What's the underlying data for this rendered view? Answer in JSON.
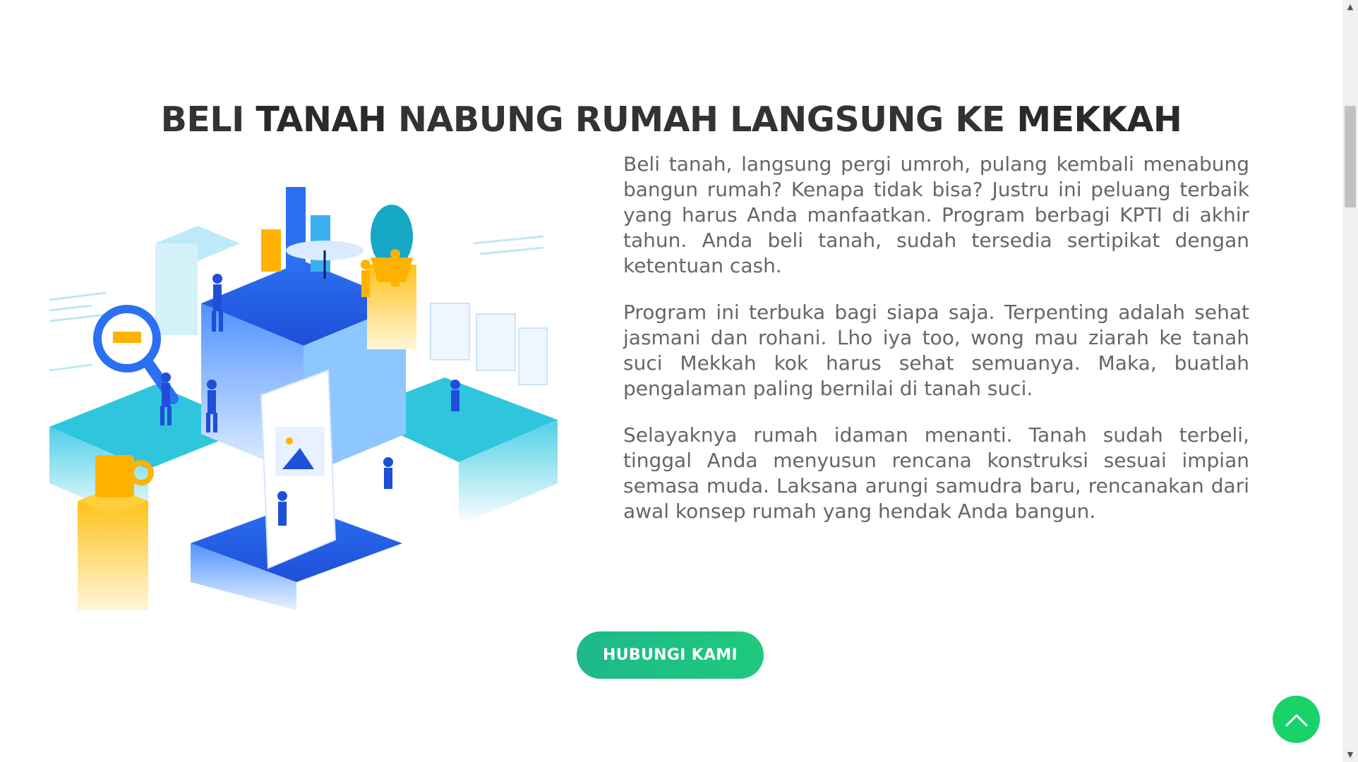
{
  "heading": {
    "part1": "BELI ",
    "bold1": "TANAH",
    "part2": " NABUNG RUMAH LANGSUNG KE ",
    "bold2": "MEKKAH"
  },
  "paragraphs": [
    "Beli tanah, langsung pergi umroh, pulang kembali menabung bangun rumah? Kenapa tidak bisa? Justru ini peluang terbaik yang harus Anda manfaatkan. Program berbagi KPTI di akhir tahun. Anda beli tanah, sudah tersedia sertipikat dengan ketentuan cash.",
    "Program ini terbuka bagi siapa saja. Terpenting adalah sehat jasmani dan rohani. Lho iya too, wong mau ziarah ke tanah suci Mekkah kok harus sehat semuanya. Maka, buatlah pengalaman paling bernilai di tanah suci.",
    "Selayaknya rumah idaman menanti. Tanah sudah terbeli, tinggal Anda menyusun rencana konstruksi sesuai impian semasa muda. Laksana arungi samudra baru, rencanakan dari awal konsep rumah yang hendak Anda bangun."
  ],
  "cta": {
    "label": "HUBUNGI KAMI"
  },
  "icons": {
    "illustration": "isometric-team-illustration",
    "to_top": "chevron-up-icon",
    "scroll_up": "triangle-up-icon",
    "scroll_down": "triangle-down-icon"
  },
  "colors": {
    "cta": "#1db88c",
    "to_top": "#19d36a",
    "text": "#666666",
    "heading": "#333333"
  }
}
